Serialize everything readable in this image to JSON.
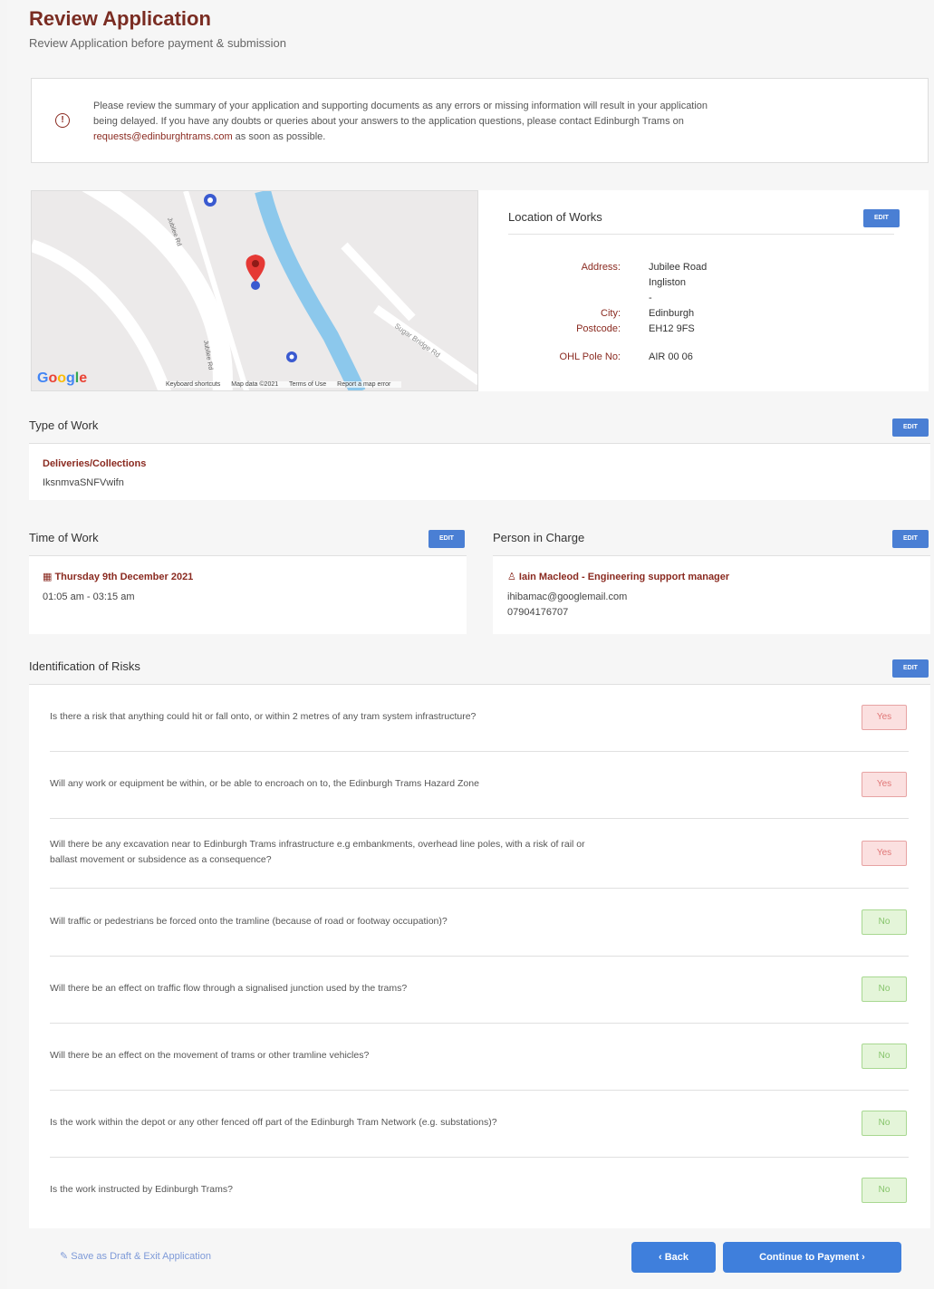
{
  "header": {
    "title": "Review Application",
    "subtitle": "Review Application before payment & submission"
  },
  "notice": {
    "icon": "info-icon",
    "text_line1": "Please review the summary of your application and supporting documents as any errors or missing information will result in your application",
    "text_line2": "being delayed. If you have any doubts or queries about your answers to the application questions, please contact Edinburgh Trams on",
    "email": "requests@edinburghtrams.com",
    "text_tail": " as soon as possible."
  },
  "map": {
    "logo": "Google",
    "roads": [
      "Jubilee Rd",
      "Jubilee Rd",
      "Sugar Bridge Rd"
    ],
    "footer": [
      "Keyboard shortcuts",
      "Map data ©2021",
      "Terms of Use",
      "Report a map error"
    ]
  },
  "location": {
    "title": "Location of Works",
    "edit_label": "EDIT",
    "address_label": "Address:",
    "address_line1": "Jubilee Road",
    "address_line2": "Ingliston",
    "address_line3": "-",
    "city_label": "City:",
    "city": "Edinburgh",
    "postcode_label": "Postcode:",
    "postcode": "EH12 9FS",
    "pole_label": "OHL Pole No:",
    "pole": "AIR 00 06"
  },
  "type_of_work": {
    "title": "Type of Work",
    "edit_label": "EDIT",
    "category": "Deliveries/Collections",
    "detail": "IksnmvaSNFVwifn"
  },
  "time_of_work": {
    "title": "Time of Work",
    "edit_label": "EDIT",
    "date": "Thursday 9th December 2021",
    "time": "01:05 am - 03:15 am"
  },
  "person_in_charge": {
    "title": "Person in Charge",
    "edit_label": "EDIT",
    "name": "Iain Macleod - Engineering support manager",
    "email": "ihibamac@googlemail.com",
    "phone": "07904176707"
  },
  "risks": {
    "title": "Identification of Risks",
    "edit_label": "EDIT",
    "items": [
      {
        "q1": "Is there a risk that anything could hit or fall onto, or within 2 metres of any tram system infrastructure?",
        "q2": "",
        "answer": "Yes"
      },
      {
        "q1": "Will any work or equipment be within, or be able to encroach on to, the Edinburgh Trams Hazard Zone",
        "q2": "",
        "answer": "Yes"
      },
      {
        "q1": "Will there be any excavation near to Edinburgh Trams infrastructure e.g embankments, overhead line poles, with a risk of rail or",
        "q2": "ballast movement or subsidence as a consequence?",
        "answer": "Yes"
      },
      {
        "q1": "Will traffic or pedestrians be forced onto the tramline (because of road or footway occupation)?",
        "q2": "",
        "answer": "No"
      },
      {
        "q1": "Will there be an effect on traffic flow through a signalised junction used by the trams?",
        "q2": "",
        "answer": "No"
      },
      {
        "q1": "Will there be an effect on the movement of trams or other tramline vehicles?",
        "q2": "",
        "answer": "No"
      },
      {
        "q1": "Is the work within the depot or any other fenced off part of the Edinburgh Tram Network (e.g. substations)?",
        "q2": "",
        "answer": "No"
      },
      {
        "q1": "Is the work instructed by Edinburgh Trams?",
        "q2": "",
        "answer": "No"
      }
    ]
  },
  "footer": {
    "save_label": "Save as Draft & Exit Application",
    "back_label": "‹  Back",
    "continue_label": "Continue to Payment  ›"
  },
  "colors": {
    "title": "#7a2c22",
    "accent": "#3f7fdc",
    "yes_bg": "#fbe0e0",
    "no_bg": "#e4f5d9"
  }
}
